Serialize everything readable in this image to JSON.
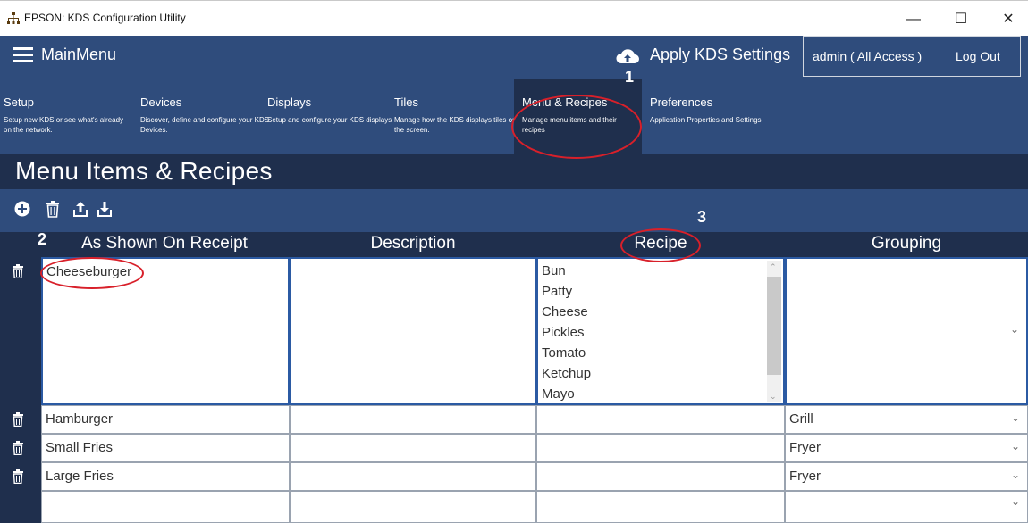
{
  "window": {
    "title": "EPSON: KDS Configuration Utility"
  },
  "topbar": {
    "menu_label": "MainMenu",
    "apply_label": "Apply KDS Settings",
    "user_label": "admin  (  All Access  )",
    "logout_label": "Log Out"
  },
  "nav": {
    "items": [
      {
        "title": "Setup",
        "desc": "Setup new KDS or see what's already on the network."
      },
      {
        "title": "Devices",
        "desc": "Discover, define and configure your KDS Devices."
      },
      {
        "title": "Displays",
        "desc": "Setup and configure your KDS displays"
      },
      {
        "title": "Tiles",
        "desc": "Manage how the KDS displays tiles on the screen."
      },
      {
        "title": "Menu & Recipes",
        "desc": "Manage menu items and their recipes"
      },
      {
        "title": "Preferences",
        "desc": "Application Properties and Settings"
      }
    ],
    "active_index": 4
  },
  "page": {
    "title": "Menu Items & Recipes"
  },
  "toolbar": {
    "icons": [
      "add-icon",
      "trash-icon",
      "upload-icon",
      "download-icon"
    ]
  },
  "grid": {
    "columns": [
      "As Shown On Receipt",
      "Description",
      "Recipe",
      "Grouping"
    ],
    "rows": [
      {
        "receipt": "Cheeseburger",
        "description": "",
        "recipe": [
          "Bun",
          "Patty",
          "Cheese",
          "Pickles",
          "Tomato",
          "Ketchup",
          "Mayo"
        ],
        "grouping": ""
      },
      {
        "receipt": "Hamburger",
        "description": "",
        "recipe": [],
        "grouping": "Grill"
      },
      {
        "receipt": "Small Fries",
        "description": "",
        "recipe": [],
        "grouping": "Fryer"
      },
      {
        "receipt": "Large Fries",
        "description": "",
        "recipe": [],
        "grouping": "Fryer"
      },
      {
        "receipt": "",
        "description": "",
        "recipe": [],
        "grouping": ""
      }
    ]
  },
  "annotations": {
    "labels": [
      "1",
      "2",
      "3"
    ]
  },
  "colors": {
    "header_blue": "#2f4c7c",
    "dark_blue": "#1f2f4d",
    "highlight_red": "#d8202a"
  }
}
